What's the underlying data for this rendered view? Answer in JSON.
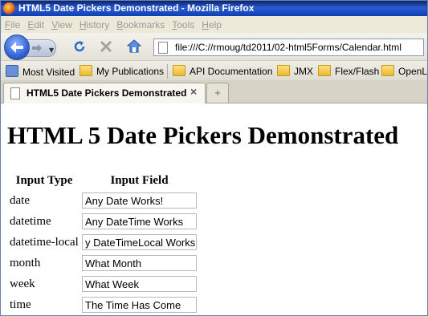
{
  "window": {
    "title": "HTML5 Date Pickers Demonstrated - Mozilla Firefox"
  },
  "menu": [
    {
      "label": "File",
      "key": "F",
      "rest": "ile"
    },
    {
      "label": "Edit",
      "key": "E",
      "rest": "dit"
    },
    {
      "label": "View",
      "key": "V",
      "rest": "iew"
    },
    {
      "label": "History",
      "key": "H",
      "rest": "istory"
    },
    {
      "label": "Bookmarks",
      "key": "B",
      "rest": "ookmarks"
    },
    {
      "label": "Tools",
      "key": "T",
      "rest": "ools"
    },
    {
      "label": "Help",
      "key": "H",
      "rest": "elp"
    }
  ],
  "nav": {
    "url": "file:///C://rmoug/td2011/02-html5Forms/Calendar.html"
  },
  "bookmarks": [
    {
      "label": "Most Visited",
      "icon": "most-visited-icon"
    },
    {
      "label": "My Publications",
      "icon": "folder-icon"
    },
    {
      "label": "API Documentation",
      "icon": "folder-icon"
    },
    {
      "label": "JMX",
      "icon": "folder-icon"
    },
    {
      "label": "Flex/Flash",
      "icon": "folder-icon"
    },
    {
      "label": "OpenLa",
      "icon": "folder-icon"
    }
  ],
  "tab": {
    "label": "HTML5 Date Pickers Demonstrated",
    "close": "×",
    "new_tab": "+"
  },
  "page": {
    "heading": "HTML 5 Date Pickers Demonstrated",
    "columns": [
      "Input Type",
      "Input Field"
    ],
    "rows": [
      {
        "type": "date",
        "value": "Any Date Works!"
      },
      {
        "type": "datetime",
        "value": "Any DateTime Works"
      },
      {
        "type": "datetime-local",
        "value": "y DateTimeLocal Works"
      },
      {
        "type": "month",
        "value": "What Month"
      },
      {
        "type": "week",
        "value": "What Week"
      },
      {
        "type": "time",
        "value": "The Time Has Come"
      }
    ]
  },
  "colors": {
    "titlebar": "#0a246a",
    "menubar": "#ece9d8",
    "disabled_menu_text": "#9a9a9a"
  }
}
